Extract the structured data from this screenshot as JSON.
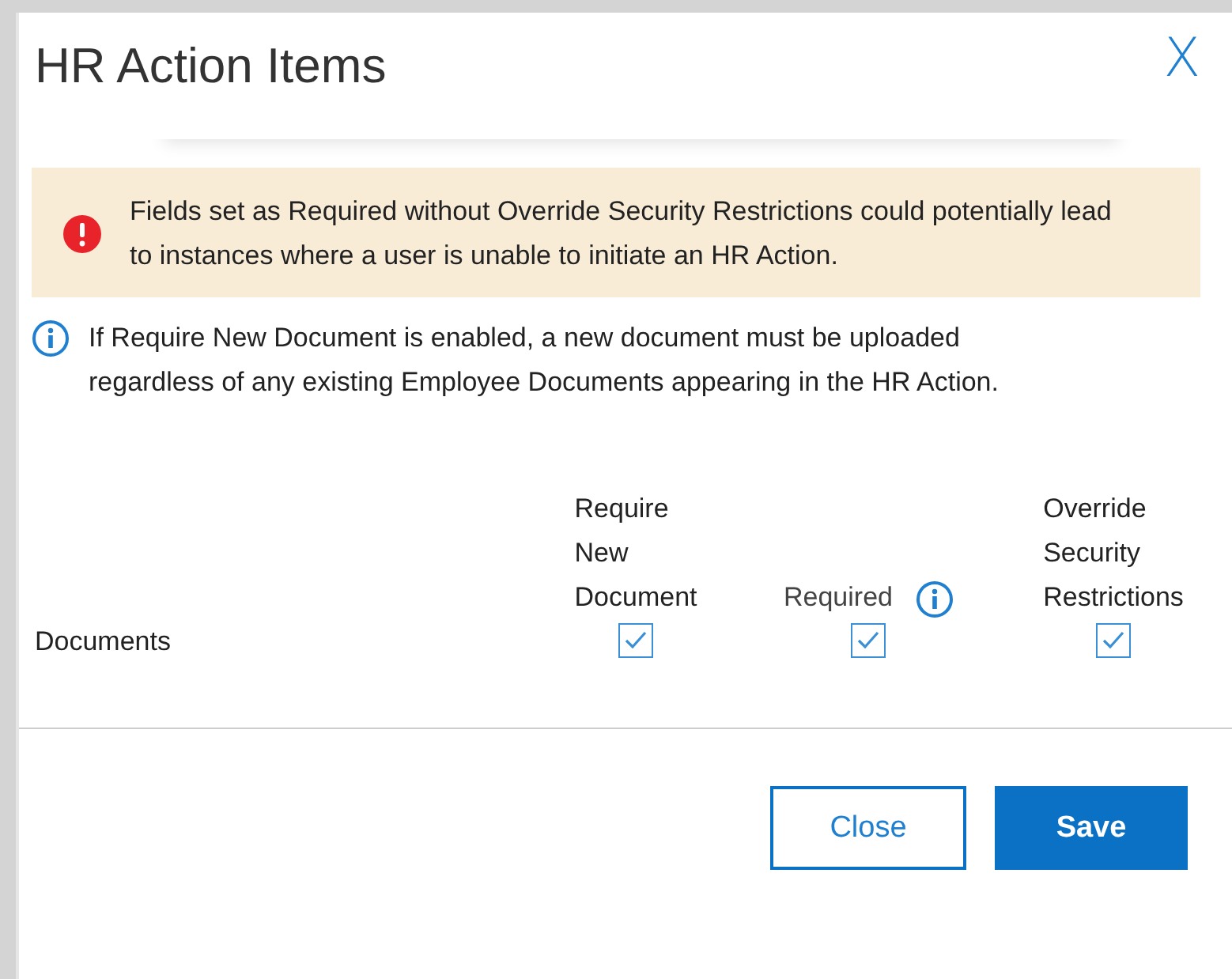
{
  "dialog": {
    "title": "HR Action Items",
    "close_icon_label": "X"
  },
  "warning": {
    "text": "Fields set as Required without Override Security Restrictions could potentially lead to instances where a user is unable to initiate an HR Action."
  },
  "info": {
    "text": "If Require New Document is enabled, a new document must be uploaded regardless of any existing Employee Documents appearing in the HR Action."
  },
  "table": {
    "columns": [
      {
        "label": "Require New Document",
        "info": false
      },
      {
        "label": "Required",
        "info": true
      },
      {
        "label": "Override Security Restrictions",
        "info": false
      }
    ],
    "rows": [
      {
        "label": "Documents",
        "values": [
          {
            "checked": true
          },
          {
            "checked": true
          },
          {
            "checked": true
          }
        ]
      }
    ]
  },
  "buttons": [
    {
      "label": "Close",
      "kind": "secondary"
    },
    {
      "label": "Save",
      "kind": "primary"
    }
  ]
}
